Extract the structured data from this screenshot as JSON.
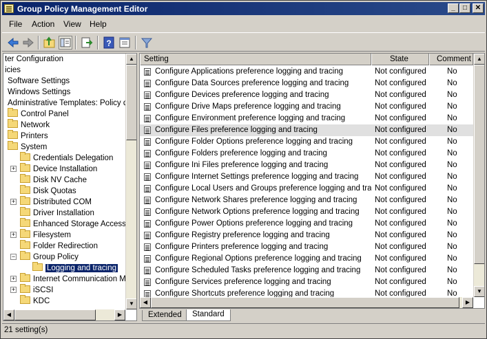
{
  "window": {
    "title": "Group Policy Management Editor",
    "minimize_glyph": "_",
    "maximize_glyph": "□",
    "close_glyph": "✕"
  },
  "menu": [
    "File",
    "Action",
    "View",
    "Help"
  ],
  "toolbar": {
    "icons": [
      "back-arrow-icon",
      "forward-arrow-icon",
      "up-folder-icon",
      "show-hide-tree-icon",
      "export-list-icon",
      "help-icon",
      "properties-icon",
      "filter-icon"
    ]
  },
  "tree": {
    "items": [
      {
        "label": "ter Configuration"
      },
      {
        "label": "icies"
      },
      {
        "label": "Software Settings"
      },
      {
        "label": "Windows Settings"
      },
      {
        "label": "Administrative Templates: Policy de"
      },
      {
        "label": "Control Panel"
      },
      {
        "label": "Network"
      },
      {
        "label": "Printers"
      },
      {
        "label": "System"
      },
      {
        "label": "Credentials Delegation"
      },
      {
        "label": "Device Installation"
      },
      {
        "label": "Disk NV Cache"
      },
      {
        "label": "Disk Quotas"
      },
      {
        "label": "Distributed COM"
      },
      {
        "label": "Driver Installation"
      },
      {
        "label": "Enhanced Storage Access"
      },
      {
        "label": "Filesystem"
      },
      {
        "label": "Folder Redirection"
      },
      {
        "label": "Group Policy"
      },
      {
        "label": "Logging and tracing"
      },
      {
        "label": "Internet Communication Ma"
      },
      {
        "label": "iSCSI"
      },
      {
        "label": "KDC"
      }
    ]
  },
  "list": {
    "columns": [
      "Setting",
      "State",
      "Comment"
    ],
    "rows": [
      {
        "setting": "Configure Applications preference logging and tracing",
        "state": "Not configured",
        "comment": "No"
      },
      {
        "setting": "Configure Data Sources preference logging and tracing",
        "state": "Not configured",
        "comment": "No"
      },
      {
        "setting": "Configure Devices preference logging and tracing",
        "state": "Not configured",
        "comment": "No"
      },
      {
        "setting": "Configure Drive Maps preference logging and tracing",
        "state": "Not configured",
        "comment": "No"
      },
      {
        "setting": "Configure Environment preference logging and tracing",
        "state": "Not configured",
        "comment": "No"
      },
      {
        "setting": "Configure Files preference logging and tracing",
        "state": "Not configured",
        "comment": "No"
      },
      {
        "setting": "Configure Folder Options preference logging and tracing",
        "state": "Not configured",
        "comment": "No"
      },
      {
        "setting": "Configure Folders preference logging and tracing",
        "state": "Not configured",
        "comment": "No"
      },
      {
        "setting": "Configure Ini Files preference logging and tracing",
        "state": "Not configured",
        "comment": "No"
      },
      {
        "setting": "Configure Internet Settings preference logging and tracing",
        "state": "Not configured",
        "comment": "No"
      },
      {
        "setting": "Configure Local Users and Groups preference logging and tracing",
        "state": "Not configured",
        "comment": "No"
      },
      {
        "setting": "Configure Network Shares preference logging and tracing",
        "state": "Not configured",
        "comment": "No"
      },
      {
        "setting": "Configure Network Options preference logging and tracing",
        "state": "Not configured",
        "comment": "No"
      },
      {
        "setting": "Configure Power Options preference logging and tracing",
        "state": "Not configured",
        "comment": "No"
      },
      {
        "setting": "Configure Registry preference logging and tracing",
        "state": "Not configured",
        "comment": "No"
      },
      {
        "setting": "Configure Printers preference logging and tracing",
        "state": "Not configured",
        "comment": "No"
      },
      {
        "setting": "Configure Regional Options preference logging and tracing",
        "state": "Not configured",
        "comment": "No"
      },
      {
        "setting": "Configure Scheduled Tasks preference logging and tracing",
        "state": "Not configured",
        "comment": "No"
      },
      {
        "setting": "Configure Services preference logging and tracing",
        "state": "Not configured",
        "comment": "No"
      },
      {
        "setting": "Configure Shortcuts preference logging and tracing",
        "state": "Not configured",
        "comment": "No"
      }
    ]
  },
  "tabs": [
    "Extended",
    "Standard"
  ],
  "status": "21 setting(s)",
  "colors": {
    "titlebar": "#0a246a",
    "selection": "#0a246a",
    "highlight_row": "#e0e0e0"
  }
}
